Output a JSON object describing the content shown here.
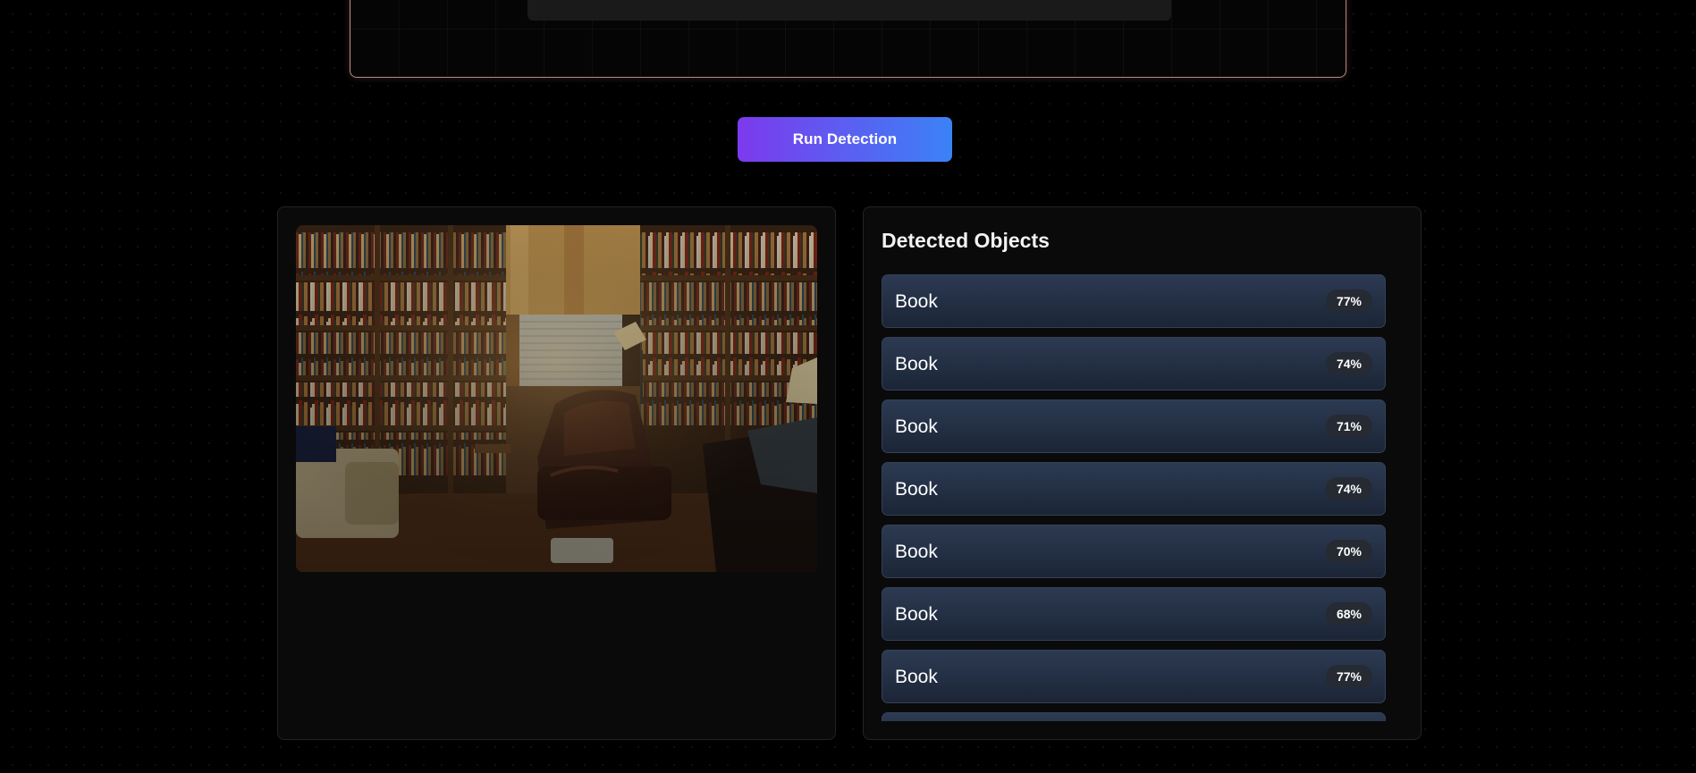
{
  "actions": {
    "run_label": "Run Detection"
  },
  "colors": {
    "background": "#000000",
    "button_gradient_start": "#7c3aed",
    "button_gradient_end": "#3b82f6",
    "panel_background": "#0a0a0a",
    "item_background": "#2c3a52"
  },
  "results": {
    "title": "Detected Objects",
    "items": [
      {
        "label": "Book",
        "confidence": "77%"
      },
      {
        "label": "Book",
        "confidence": "74%"
      },
      {
        "label": "Book",
        "confidence": "71%"
      },
      {
        "label": "Book",
        "confidence": "74%"
      },
      {
        "label": "Book",
        "confidence": "70%"
      },
      {
        "label": "Book",
        "confidence": "68%"
      },
      {
        "label": "Book",
        "confidence": "77%"
      },
      {
        "label": "",
        "confidence": ""
      }
    ]
  },
  "preview": {
    "image": "library-room-photo"
  }
}
